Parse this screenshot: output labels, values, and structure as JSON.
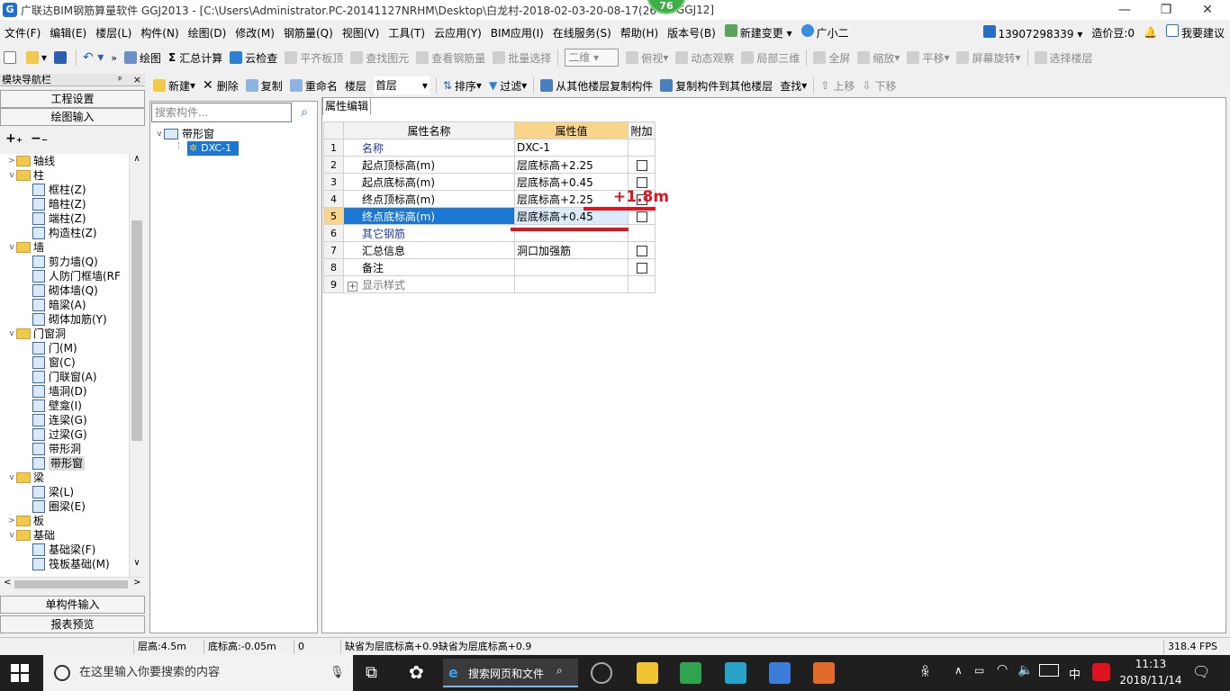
{
  "window": {
    "title": "广联达BIM钢筋算量软件 GGJ2013 - [C:\\Users\\Administrator.PC-20141127NRHM\\Desktop\\白龙村-2018-02-03-20-08-17(26",
    "title_tail": "GGJ12]",
    "badge": "76"
  },
  "menu": [
    "文件(F)",
    "编辑(E)",
    "楼层(L)",
    "构件(N)",
    "绘图(D)",
    "修改(M)",
    "钢筋量(Q)",
    "视图(V)",
    "工具(T)",
    "云应用(Y)",
    "BIM应用(I)",
    "在线服务(S)",
    "帮助(H)",
    "版本号(B)"
  ],
  "menu_new_change": "新建变更",
  "menu_assistant": "广小二",
  "account": "13907298339",
  "credit": "造价豆:0",
  "suggest": "我要建议",
  "toolbar1": {
    "draw": "绘图",
    "summary": "汇总计算",
    "cloud_check": "云检查",
    "flat_top": "平齐板顶",
    "find_elem": "查找图元",
    "view_rebar": "查看钢筋量",
    "batch_select": "批量选择",
    "view_mode": "二维",
    "overlook": "俯视",
    "dynamic": "动态观察",
    "local3d": "局部三维",
    "fullscreen": "全屏",
    "zoom": "缩放",
    "pan": "平移",
    "rotate": "屏幕旋转",
    "select_floor": "选择楼层"
  },
  "toolbar2": {
    "new": "新建",
    "delete": "删除",
    "copy": "复制",
    "rename": "重命名",
    "floor_label": "楼层",
    "floor_value": "首层",
    "sort": "排序",
    "filter": "过滤",
    "copy_from": "从其他楼层复制构件",
    "copy_to": "复制构件到其他楼层",
    "find": "查找",
    "move_up": "上移",
    "move_down": "下移"
  },
  "nav": {
    "header": "模块导航栏",
    "pin": "ᵖ",
    "close": "×",
    "project_settings": "工程设置",
    "draw_input": "绘图输入",
    "single_input": "单构件输入",
    "report_preview": "报表预览",
    "tree": [
      {
        "label": "轴线",
        "level": 0,
        "type": "folder",
        "toggle": ">"
      },
      {
        "label": "柱",
        "level": 0,
        "type": "folder",
        "toggle": "v"
      },
      {
        "label": "框柱(Z)",
        "level": 1,
        "type": "item"
      },
      {
        "label": "暗柱(Z)",
        "level": 1,
        "type": "item"
      },
      {
        "label": "端柱(Z)",
        "level": 1,
        "type": "item"
      },
      {
        "label": "构造柱(Z)",
        "level": 1,
        "type": "item"
      },
      {
        "label": "墙",
        "level": 0,
        "type": "folder",
        "toggle": "v"
      },
      {
        "label": "剪力墙(Q)",
        "level": 1,
        "type": "item"
      },
      {
        "label": "人防门框墙(RF",
        "level": 1,
        "type": "item"
      },
      {
        "label": "砌体墙(Q)",
        "level": 1,
        "type": "item"
      },
      {
        "label": "暗梁(A)",
        "level": 1,
        "type": "item"
      },
      {
        "label": "砌体加筋(Y)",
        "level": 1,
        "type": "item"
      },
      {
        "label": "门窗洞",
        "level": 0,
        "type": "folder",
        "toggle": "v"
      },
      {
        "label": "门(M)",
        "level": 1,
        "type": "item"
      },
      {
        "label": "窗(C)",
        "level": 1,
        "type": "item"
      },
      {
        "label": "门联窗(A)",
        "level": 1,
        "type": "item"
      },
      {
        "label": "墙洞(D)",
        "level": 1,
        "type": "item"
      },
      {
        "label": "壁龛(I)",
        "level": 1,
        "type": "item"
      },
      {
        "label": "连梁(G)",
        "level": 1,
        "type": "item"
      },
      {
        "label": "过梁(G)",
        "level": 1,
        "type": "item"
      },
      {
        "label": "带形洞",
        "level": 1,
        "type": "item"
      },
      {
        "label": "带形窗",
        "level": 1,
        "type": "item",
        "selected": true
      },
      {
        "label": "梁",
        "level": 0,
        "type": "folder",
        "toggle": "v"
      },
      {
        "label": "梁(L)",
        "level": 1,
        "type": "item"
      },
      {
        "label": "圈梁(E)",
        "level": 1,
        "type": "item"
      },
      {
        "label": "板",
        "level": 0,
        "type": "folder",
        "toggle": ">"
      },
      {
        "label": "基础",
        "level": 0,
        "type": "folder",
        "toggle": "v"
      },
      {
        "label": "基础梁(F)",
        "level": 1,
        "type": "item"
      },
      {
        "label": "筏板基础(M)",
        "level": 1,
        "type": "item"
      }
    ]
  },
  "components": {
    "search_placeholder": "搜索构件...",
    "group": "带形窗",
    "item": "DXC-1"
  },
  "property": {
    "tab": "属性编辑",
    "headers": [
      "属性名称",
      "属性值",
      "附加"
    ],
    "rows": [
      {
        "num": "1",
        "name": "名称",
        "value": "DXC-1",
        "check": false,
        "blue": true
      },
      {
        "num": "2",
        "name": "起点顶标高(m)",
        "value": "层底标高+2.25",
        "check": true
      },
      {
        "num": "3",
        "name": "起点底标高(m)",
        "value": "层底标高+0.45",
        "check": true
      },
      {
        "num": "4",
        "name": "终点顶标高(m)",
        "value": "层底标高+2.25",
        "check": true
      },
      {
        "num": "5",
        "name": "终点底标高(m)",
        "value": "层底标高+0.45",
        "check": true,
        "selected": true
      },
      {
        "num": "6",
        "name": "其它钢筋",
        "value": "",
        "check": false,
        "blue": true
      },
      {
        "num": "7",
        "name": "汇总信息",
        "value": "洞口加强筋",
        "check": true
      },
      {
        "num": "8",
        "name": "备注",
        "value": "",
        "check": true
      },
      {
        "num": "9",
        "name": "显示样式",
        "value": "",
        "check": false,
        "expand": "+"
      }
    ],
    "annotation": "+1.8m"
  },
  "status": {
    "floor_height": "层高:4.5m",
    "bottom_elev": "底标高:-0.05m",
    "zero": "0",
    "message": "缺省为层底标高+0.9缺省为层底标高+0.9",
    "fps": "318.4 FPS"
  },
  "taskbar": {
    "search_text": "在这里输入你要搜索的内容",
    "browser_search": "搜索网页和文件",
    "ime": "中",
    "time": "11:13",
    "date": "2018/11/14"
  },
  "colors": {
    "selection": "#1a78d4",
    "header_value": "#f9d58c",
    "annotation": "#e0141e"
  }
}
